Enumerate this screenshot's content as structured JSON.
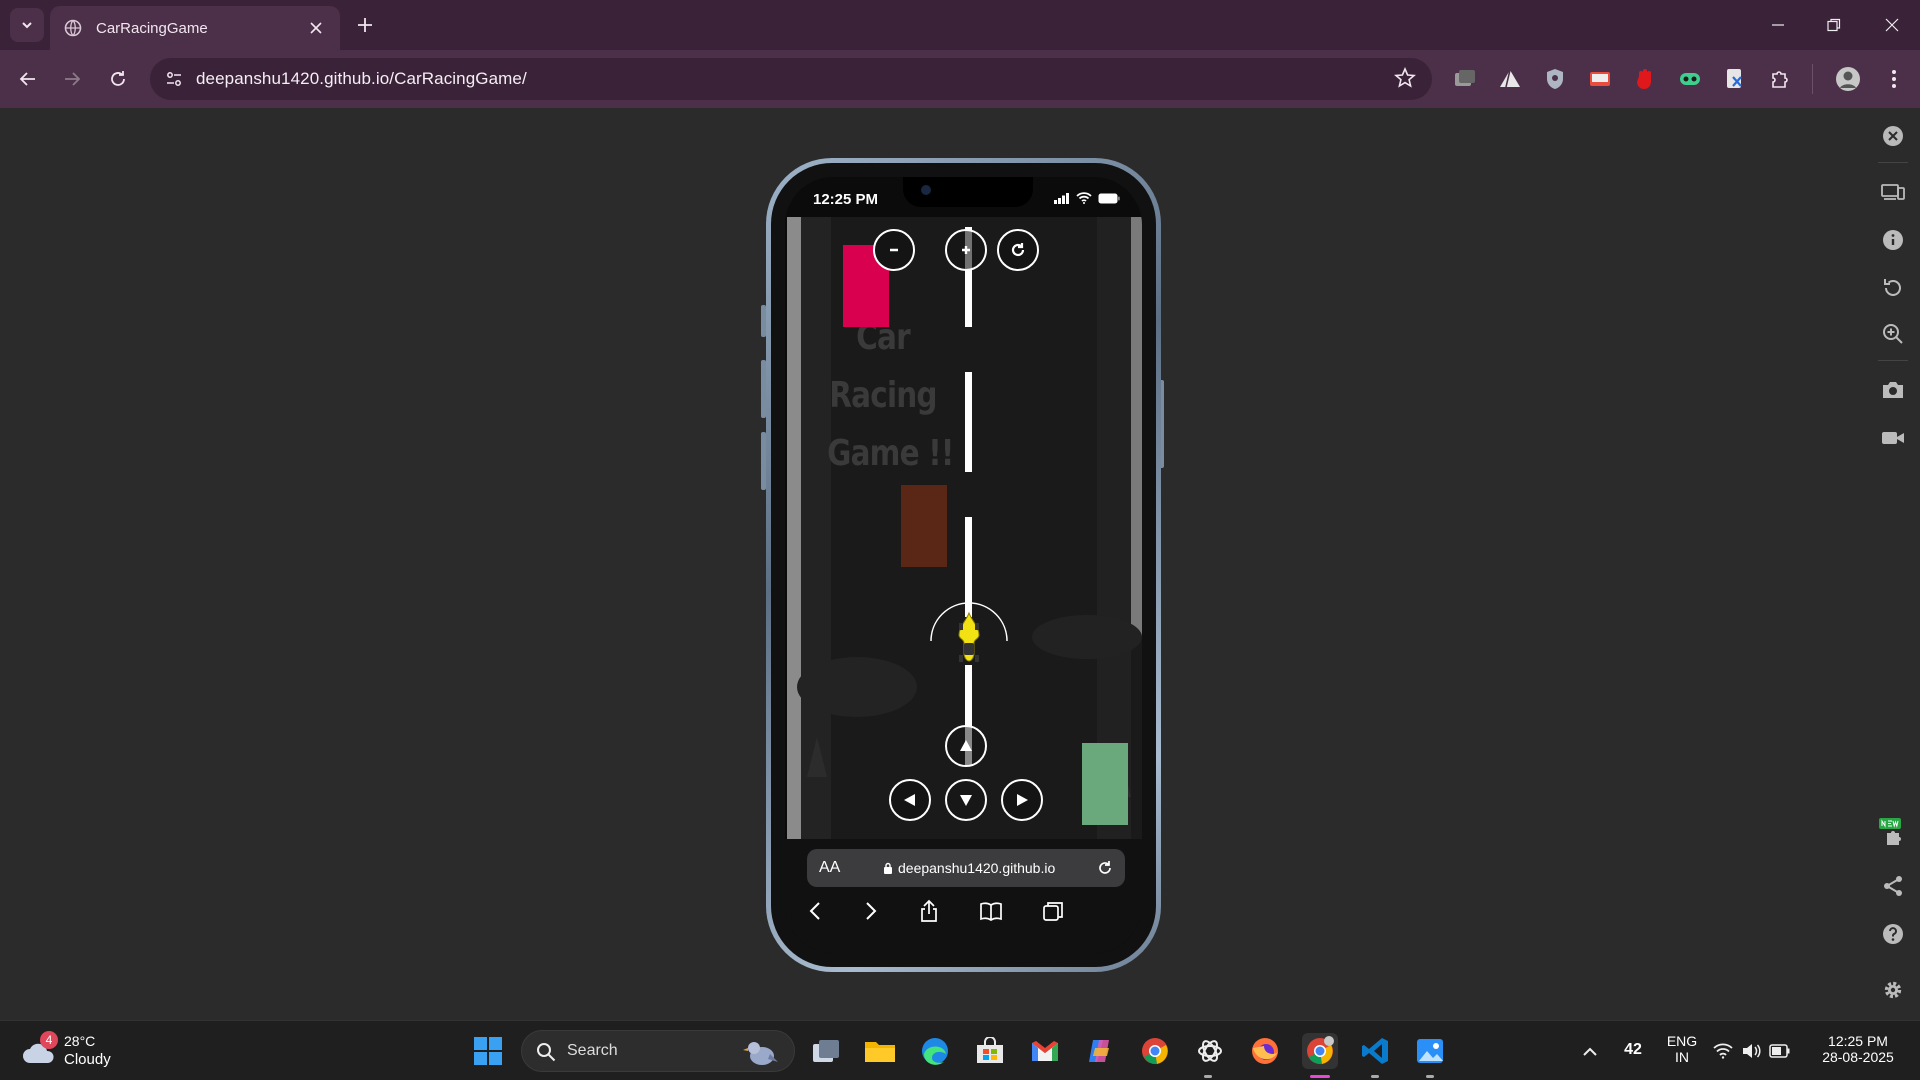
{
  "browser": {
    "tab_title": "CarRacingGame",
    "url": "deepanshu1420.github.io/CarRacingGame/",
    "window_controls": [
      "minimize",
      "restore",
      "close"
    ]
  },
  "phone": {
    "status_time": "12:25 PM",
    "game": {
      "title_line1": "Car Racing",
      "title_line2": "Game !!",
      "controls": [
        "zoom-out",
        "zoom-in",
        "restart",
        "up",
        "left",
        "down",
        "right"
      ],
      "car_colors": {
        "top": "#d9004f",
        "middle": "#5a2717",
        "bottom": "#6aa97b",
        "player": "#f2e214"
      }
    },
    "safari": {
      "text_size": "AA",
      "domain": "deepanshu1420.github.io"
    }
  },
  "taskbar": {
    "weather_badge": "4",
    "temperature": "28°C",
    "weather": "Cloudy",
    "search_placeholder": "Search",
    "tray_count": "42",
    "lang_line1": "ENG",
    "lang_line2": "IN",
    "time": "12:25 PM",
    "date": "28-08-2025"
  }
}
